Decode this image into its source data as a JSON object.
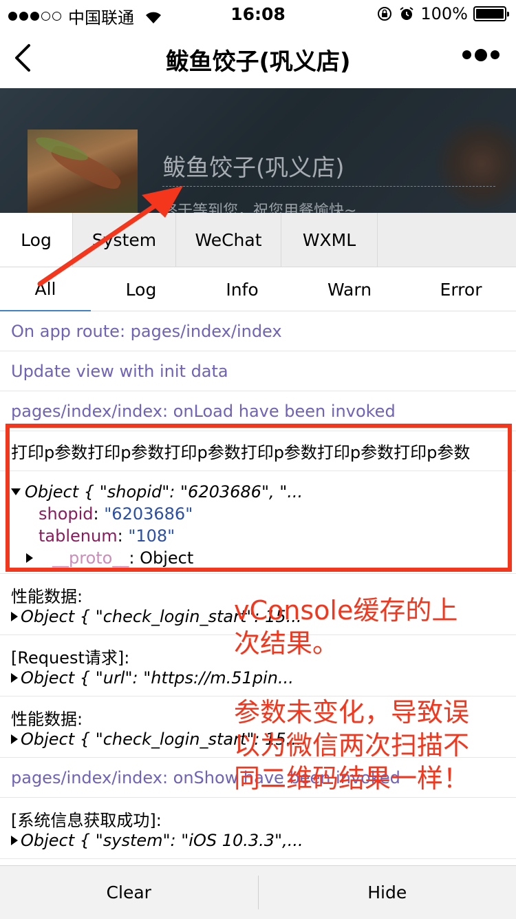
{
  "status_bar": {
    "carrier": "中国联通",
    "time": "16:08",
    "battery": "100%",
    "battery_level": 1.0
  },
  "nav": {
    "title": "鲅鱼饺子(巩义店)"
  },
  "hero": {
    "shop_name": "鲅鱼饺子(巩义店)",
    "welcome": "终于等到您，祝您用餐愉快~"
  },
  "vconsole": {
    "tabs": [
      "Log",
      "System",
      "WeChat",
      "WXML"
    ],
    "subtabs": [
      "All",
      "Log",
      "Info",
      "Warn",
      "Error"
    ],
    "logs": {
      "route": "On app route: pages/index/index",
      "update": "Update view with init data",
      "onload": "pages/index/index: onLoad have been invoked",
      "print": "打印p参数打印p参数打印p参数打印p参数打印p参数打印p参数",
      "obj_summary": "Object { \"shopid\": \"6203686\", \"...",
      "shopid_key": "shopid",
      "shopid_val": "\"6203686\"",
      "tablenum_key": "tablenum",
      "tablenum_val": "\"108\"",
      "proto_key": "__proto__",
      "proto_val": ": Object",
      "perf1_label": "性能数据:",
      "perf1_obj": "Object { \"check_login_start\": 15...",
      "req_label": "[Request请求]:",
      "req_obj": "Object { \"url\": \"https://m.51pin...",
      "perf2_label": "性能数据:",
      "perf2_obj": "Object { \"check_login_start\": 15...",
      "onshow": "pages/index/index: onShow have been invoked",
      "sys_label": "[系统信息获取成功]:",
      "sys_obj": "Object { \"system\": \"iOS 10.3.3\",..."
    },
    "footer": {
      "clear": "Clear",
      "hide": "Hide"
    }
  },
  "annotations": {
    "note1": "vConsole缓存的上次结果。",
    "note2": "参数未变化，导致误以为微信两次扫描不同二维码结果一样！",
    "color": "#f4361d"
  }
}
